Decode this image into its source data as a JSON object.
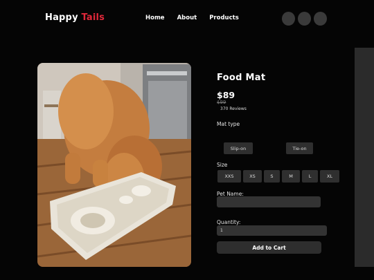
{
  "nav": {
    "brand_first": "Happy",
    "brand_second": "Tails",
    "links": [
      "Home",
      "About",
      "Products"
    ]
  },
  "product": {
    "title": "Food Mat",
    "price": "$89",
    "old_price": "$99",
    "reviews": "370 Reviews",
    "mat_type_label": "Mat type",
    "mat_types": [
      "Slip-on",
      "Tie-on"
    ],
    "size_label": "Size",
    "sizes": [
      "XXS",
      "XS",
      "S",
      "M",
      "L",
      "XL"
    ],
    "pet_name_label": "Pet Name:",
    "quantity_label": "Quantity:",
    "quantity_value": "1",
    "add_to_cart": "Add to Cart"
  },
  "colors": {
    "accent": "#e0283a",
    "background": "#050505",
    "control": "#2f2f2f"
  }
}
